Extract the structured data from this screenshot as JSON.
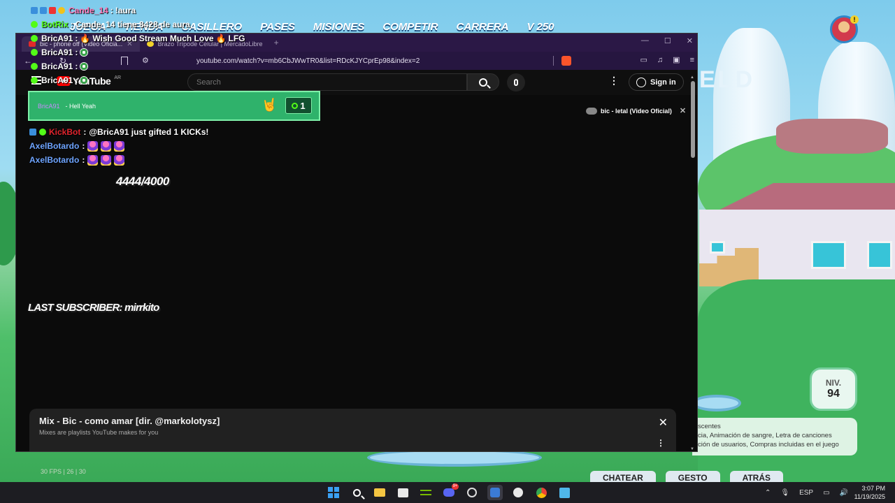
{
  "game": {
    "nav": [
      "JUEGA",
      "TIENDA",
      "CASILLERO",
      "PASES",
      "MISIONES",
      "COMPETIR",
      "CARRERA"
    ],
    "currency": "250",
    "level_label": "NIV.",
    "level_value": "94",
    "rating_title": "scentes",
    "rating_line1": "cia, Animación de sangre, Letra de canciones",
    "rating_line2": "ción de usuarios, Compras incluidas en el juego",
    "bottom_buttons": [
      "CHATEAR",
      "GESTO",
      "ATRÁS"
    ],
    "sign_text": "ELD",
    "fps": "30 FPS | 26 | 30"
  },
  "browser": {
    "tabs": [
      {
        "label": "bic - phone off (Video Oficia..."
      },
      {
        "label": "Brazo Trípode Celular | MercadoLibre"
      }
    ],
    "url": "youtube.com/watch?v=mb6CbJWwTR0&list=RDcKJYCprEp98&index=2"
  },
  "youtube": {
    "logo_text": "YouTube",
    "country": "AR",
    "search_placeholder": "Search",
    "signin_label": "Sign in",
    "miniplayer_title": "bic - letal (Video Oficial)",
    "playlist_title": "Mix - Bic - como amar [dir. @markolotysz]",
    "playlist_subtitle": "Mixes are playlists YouTube makes for you"
  },
  "overlay": {
    "chat": [
      {
        "user": "Cande_14",
        "text": "!aura"
      },
      {
        "user": "BotRix",
        "text": "Cande_14 tiene 8428 de aura"
      },
      {
        "user": "BricA91",
        "text": "Wish Good Stream Much Love",
        "suffix": "LFG"
      },
      {
        "user": "BricA91",
        "text": ""
      },
      {
        "user": "BricA91",
        "text": ""
      },
      {
        "user": "BricA91",
        "text": ""
      }
    ],
    "gift": {
      "user": "BricA91",
      "message": "- Hell Yeah",
      "count": "1"
    },
    "feed": [
      {
        "user": "KickBot",
        "text": "@BricA91 just gifted 1 KICKs!"
      },
      {
        "user": "AxelBotardo",
        "text": ""
      },
      {
        "user": "AxelBotardo",
        "text": ""
      }
    ],
    "goal": "4444/4000",
    "last_subscriber": "LAST SUBSCRIBER: mirrkito"
  },
  "taskbar": {
    "lang": "ESP",
    "time": "3:07 PM",
    "date": "11/19/2025",
    "discord_badge": "9+"
  },
  "colors": {
    "kick_green": "#53fc18",
    "titlebar": "#2b1846",
    "gift_bar": "#2fb26b"
  }
}
